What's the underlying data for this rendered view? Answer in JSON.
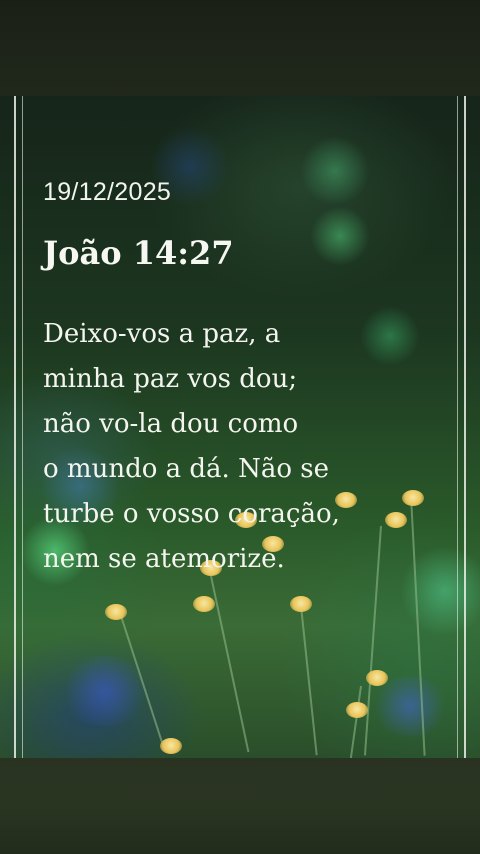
{
  "post": {
    "date": "19/12/2025",
    "reference": "João 14:27",
    "verse_lines": [
      "Deixo-vos a paz, a",
      "minha paz vos dou;",
      "não vo-la dou como",
      "o mundo a dá. Não se",
      "turbe o vosso coração,",
      "nem se atemorize."
    ]
  },
  "colors": {
    "text": "#f4f5ef",
    "frame": "#ebf0e6",
    "flower": "#e9c45b",
    "bokeh_green": "#3fbf6a",
    "bokeh_blue": "#3f6fd0"
  }
}
